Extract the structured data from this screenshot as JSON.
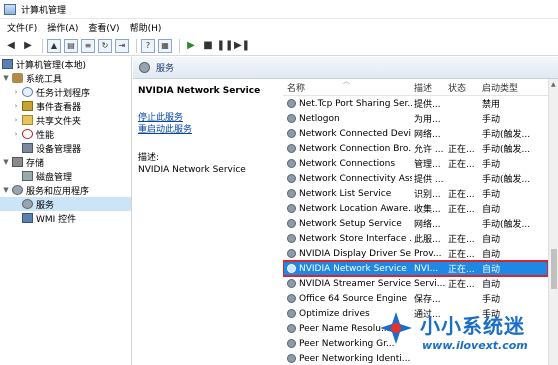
{
  "window": {
    "title": "计算机管理"
  },
  "menu": [
    "文件(F)",
    "操作(A)",
    "查看(V)",
    "帮助(H)"
  ],
  "tree": {
    "root": "计算机管理(本地)",
    "system_tools": "系统工具",
    "task_scheduler": "任务计划程序",
    "event_viewer": "事件查看器",
    "shared_folders": "共享文件夹",
    "performance": "性能",
    "device_manager": "设备管理器",
    "storage": "存储",
    "disk_management": "磁盘管理",
    "services_apps": "服务和应用程序",
    "services": "服务",
    "wmi": "WMI 控件"
  },
  "detail": {
    "header": "服务",
    "service_name": "NVIDIA Network Service",
    "stop_link": "停止此服务",
    "restart_link": "重启动此服务",
    "desc_label": "描述:",
    "desc_text": "NVIDIA Network Service"
  },
  "columns": {
    "name": "名称",
    "description": "描述",
    "status": "状态",
    "startup": "启动类型"
  },
  "services": [
    {
      "name": "Net.Tcp Port Sharing Ser...",
      "desc": "提供...",
      "status": "",
      "startup": "禁用"
    },
    {
      "name": "Netlogon",
      "desc": "为用...",
      "status": "",
      "startup": "手动"
    },
    {
      "name": "Network Connected Devi...",
      "desc": "网络...",
      "status": "",
      "startup": "手动(触发..."
    },
    {
      "name": "Network Connection Bro...",
      "desc": "允许 ...",
      "status": "正在...",
      "startup": "手动(触发..."
    },
    {
      "name": "Network Connections",
      "desc": "管理...",
      "status": "正在...",
      "startup": "手动"
    },
    {
      "name": "Network Connectivity Ass...",
      "desc": "提供 ...",
      "status": "",
      "startup": "手动(触发..."
    },
    {
      "name": "Network List Service",
      "desc": "识别...",
      "status": "正在...",
      "startup": "手动"
    },
    {
      "name": "Network Location Aware...",
      "desc": "收集...",
      "status": "正在...",
      "startup": "自动"
    },
    {
      "name": "Network Setup Service",
      "desc": "网络...",
      "status": "",
      "startup": "手动(触发..."
    },
    {
      "name": "Network Store Interface ...",
      "desc": "此服...",
      "status": "正在...",
      "startup": "自动"
    },
    {
      "name": "NVIDIA Display Driver Se...",
      "desc": "Prov...",
      "status": "正在...",
      "startup": "自动"
    },
    {
      "name": "NVIDIA Network Service",
      "desc": "NVI...",
      "status": "正在...",
      "startup": "自动",
      "selected": true
    },
    {
      "name": "NVIDIA Streamer Service",
      "desc": "Servi...",
      "status": "正在...",
      "startup": "自动"
    },
    {
      "name": "Office 64 Source Engine",
      "desc": "保存...",
      "status": "",
      "startup": "手动"
    },
    {
      "name": "Optimize drives",
      "desc": "通过...",
      "status": "",
      "startup": "手动"
    },
    {
      "name": "Peer Name Resolu...",
      "desc": "",
      "status": "",
      "startup": ""
    },
    {
      "name": "Peer Networking Gr...",
      "desc": "",
      "status": "",
      "startup": ""
    },
    {
      "name": "Peer Networking Identi...",
      "desc": "",
      "status": "",
      "startup": ""
    }
  ],
  "watermark": {
    "title": "小小系统迷",
    "url": "www.ilovext.com"
  },
  "colors": {
    "selection": "#1f88e5",
    "highlight_border": "#d9262c",
    "link": "#0645ad"
  }
}
